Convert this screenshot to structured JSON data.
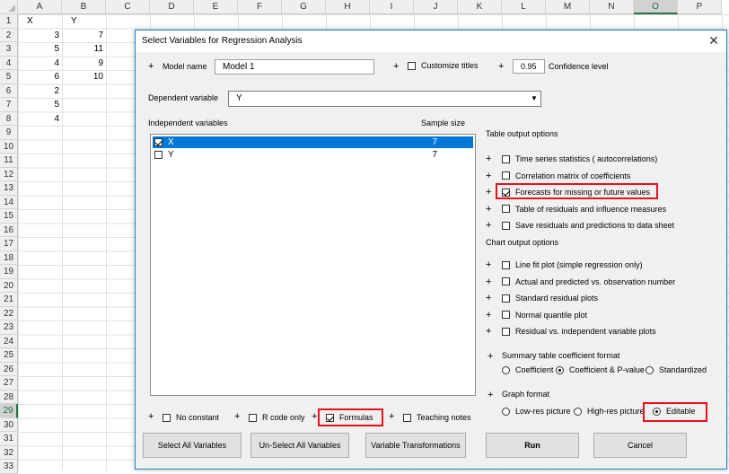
{
  "sheet": {
    "columns": [
      "A",
      "B",
      "C",
      "D",
      "E",
      "F",
      "G",
      "H",
      "I",
      "J",
      "K",
      "L",
      "M",
      "N",
      "O",
      "P"
    ],
    "selected_column": "O",
    "rows": [
      "1",
      "2",
      "3",
      "4",
      "5",
      "6",
      "7",
      "8",
      "9",
      "10",
      "11",
      "12",
      "13",
      "14",
      "15",
      "16",
      "17",
      "18",
      "19",
      "20",
      "21",
      "22",
      "23",
      "24",
      "25",
      "26",
      "27",
      "28",
      "29",
      "30",
      "31",
      "32",
      "33"
    ],
    "selected_row": "29",
    "colA": [
      "X",
      "3",
      "5",
      "4",
      "6",
      "2",
      "5",
      "4"
    ],
    "colB": [
      "Y",
      "7",
      "11",
      "9",
      "10"
    ]
  },
  "dialog": {
    "title": "Select Variables for Regression Analysis",
    "close_label": "✕",
    "plus": "+",
    "model_name_label": "Model name",
    "model_name_value": "Model 1",
    "customize_titles_label": "Customize titles",
    "confidence_value": "0.95",
    "confidence_label": "Confidence level",
    "dependent_label": "Dependent variable",
    "dependent_value": "Y",
    "independent_label": "Independent variables",
    "sample_size_label": "Sample size",
    "variables": [
      {
        "name": "X",
        "size": "7",
        "checked": true,
        "selected": true
      },
      {
        "name": "Y",
        "size": "7",
        "checked": false,
        "selected": false
      }
    ],
    "table_output_label": "Table output options",
    "table_options": [
      {
        "label": "Time series statistics ( autocorrelations)",
        "checked": false
      },
      {
        "label": "Correlation matrix of coefficients",
        "checked": false
      },
      {
        "label": "Forecasts for missing or future values",
        "checked": true
      },
      {
        "label": "Table of residuals and influence measures",
        "checked": false
      },
      {
        "label": "Save residuals and predictions to data sheet",
        "checked": false
      }
    ],
    "chart_output_label": "Chart output options",
    "chart_options": [
      {
        "label": "Line fit plot (simple regression only)",
        "checked": false
      },
      {
        "label": "Actual and predicted vs. observation number",
        "checked": false
      },
      {
        "label": "Standard residual plots",
        "checked": false
      },
      {
        "label": "Normal quantile plot",
        "checked": false
      },
      {
        "label": "Residual vs. independent variable plots",
        "checked": false
      }
    ],
    "coef_format_label": "Summary table coefficient format",
    "coef_options": [
      {
        "label": "Coefficient",
        "checked": false
      },
      {
        "label": "Coefficient & P-value",
        "checked": true
      },
      {
        "label": "Standardized",
        "checked": false
      }
    ],
    "graph_format_label": "Graph format",
    "graph_options": [
      {
        "label": "Low-res picture",
        "checked": false
      },
      {
        "label": "High-res picture",
        "checked": false
      },
      {
        "label": "Editable",
        "checked": true
      }
    ],
    "bottom_checks": [
      {
        "label": "No constant",
        "checked": false
      },
      {
        "label": "R code only",
        "checked": false
      },
      {
        "label": "Formulas",
        "checked": true
      },
      {
        "label": "Teaching notes",
        "checked": false
      }
    ],
    "buttons": {
      "select_all": "Select All Variables",
      "unselect_all": "Un-Select All Variables",
      "transformations": "Variable Transformations",
      "run": "Run",
      "cancel": "Cancel"
    },
    "highlight_color": "#e8101e",
    "selection_color": "#0078d7"
  }
}
